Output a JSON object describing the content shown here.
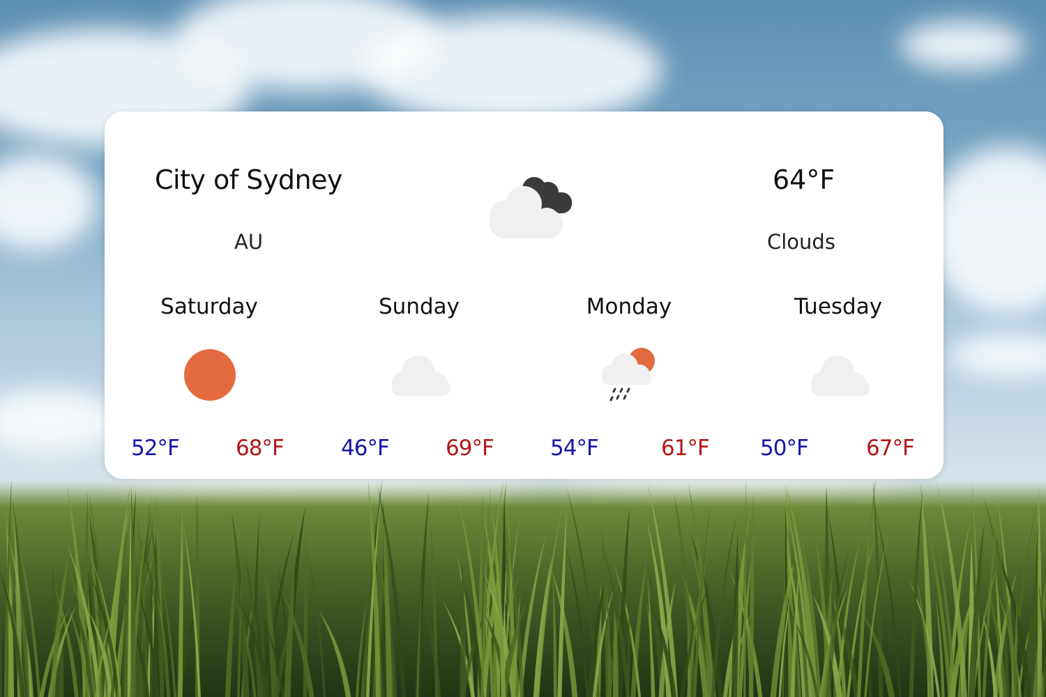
{
  "colors": {
    "low_temp": "#1616a8",
    "high_temp": "#b01818",
    "sun": "#e36a3f",
    "cloud_light": "#f0f0f0",
    "cloud_dark": "#3a3a3a",
    "card_background": "#ffffff"
  },
  "current": {
    "city": "City of Sydney",
    "country": "AU",
    "temperature": "64°F",
    "condition": "Clouds",
    "icon": "broken-clouds-icon"
  },
  "forecast": [
    {
      "day": "Saturday",
      "icon": "sun-icon",
      "low": "52°F",
      "high": "68°F"
    },
    {
      "day": "Sunday",
      "icon": "cloud-icon",
      "low": "46°F",
      "high": "69°F"
    },
    {
      "day": "Monday",
      "icon": "rain-sun-cloud-icon",
      "low": "54°F",
      "high": "61°F"
    },
    {
      "day": "Tuesday",
      "icon": "cloud-icon",
      "low": "50°F",
      "high": "67°F"
    }
  ]
}
